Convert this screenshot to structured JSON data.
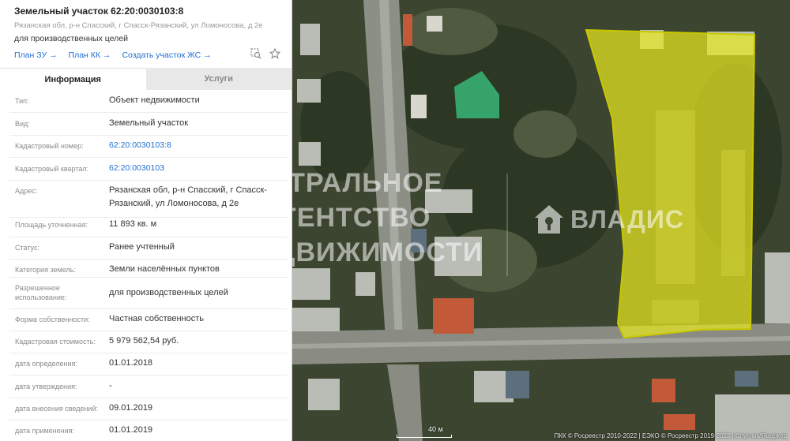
{
  "header": {
    "title": "Земельный участок 62:20:0030103:8",
    "address": "Рязанская обл, р-н Спасский, г Спасск-Рязанский, ул Ломоносова, д 2е",
    "purpose": "для производственных целей",
    "links": [
      "План ЗУ →",
      "План КК →",
      "Создать участок ЖС →"
    ]
  },
  "tabs": {
    "info": "Информация",
    "services": "Услуги"
  },
  "info": {
    "type_label": "Тип:",
    "type_value": "Объект недвижимости",
    "kind_label": "Вид:",
    "kind_value": "Земельный участок",
    "cadnum_label": "Кадастровый номер:",
    "cadnum_value": "62:20:0030103:8",
    "quarter_label": "Кадастровый квартал:",
    "quarter_value": "62:20:0030103",
    "address_label": "Адрес:",
    "address_value": "Рязанская обл, р-н Спасский, г Спасск-Рязанский, ул Ломоносова, д 2е",
    "area_label": "Площадь уточненная:",
    "area_value": "11 893 кв. м",
    "status_label": "Статус:",
    "status_value": "Ранее учтенный",
    "category_label": "Категория земель:",
    "category_value": "Земли населённых пунктов",
    "permitted_label": "Разрешенное использование:",
    "permitted_value": "для производственных целей",
    "ownership_label": "Форма собственности:",
    "ownership_value": "Частная собственность",
    "cost_label": "Кадастровая стоимость:",
    "cost_value": "5 979 562,54 руб.",
    "def_date_label": "дата определения:",
    "def_date_value": "01.01.2018",
    "approve_date_label": "дата утверждения:",
    "approve_date_value": "-",
    "entry_date_label": "дата внесения сведений:",
    "entry_date_value": "09.01.2019",
    "apply_date_label": "дата применения:",
    "apply_date_value": "01.01.2019"
  },
  "map": {
    "watermark_lines": [
      "ЦЕНТРАЛЬНОЕ",
      "АГЕНТСТВО",
      "НЕДВИЖИМОСТИ"
    ],
    "brand": "ВЛАДИС",
    "scale_label": "40 м",
    "attribution": "ПКК © Росреестр 2010-2022 | ЕЭКО © Росреестр 2019-2022 | Спутник/Ямаркер",
    "colors": {
      "parcel_fill": "#e8e81e",
      "parcel_stroke": "#c8c800"
    }
  },
  "icons": {
    "zoom": "zoom-to-icon",
    "favorite": "star-icon",
    "brand_logo": "house-key-icon"
  }
}
